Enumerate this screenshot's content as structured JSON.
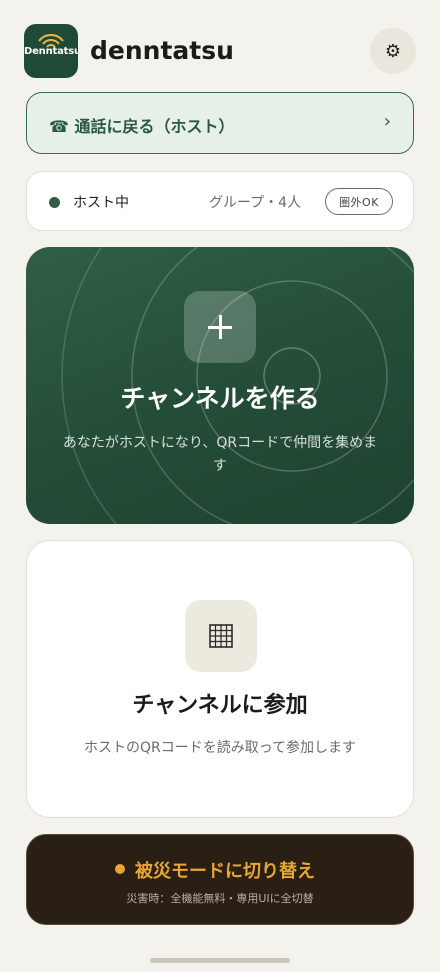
{
  "header": {
    "logo_text": "Denntatsu",
    "app_name": "denntatsu",
    "settings_icon": "gear-icon"
  },
  "return_banner": {
    "label": "☎ 通話に戻る（ホスト）",
    "chevron": "›"
  },
  "status": {
    "role": "ホスト中",
    "group": "グループ・4人",
    "signal": "圏外OK",
    "dot_color": "#2f5d45"
  },
  "create_channel": {
    "icon": "plus-icon",
    "title": "チャンネルを作る",
    "description": "あなたがホストになり、QRコードで仲間を集めます"
  },
  "join_channel": {
    "icon": "qr-grid-icon",
    "title": "チャンネルに参加",
    "description": "ホストのQRコードを読み取って参加します"
  },
  "disaster_mode": {
    "label": "被災モードに切り替え",
    "subtitle": "災害時：全機能無料・専用UIに全切替",
    "accent": "#e8a732"
  },
  "colors": {
    "brand_green": "#1f4a35",
    "background": "#f4f2ec"
  }
}
